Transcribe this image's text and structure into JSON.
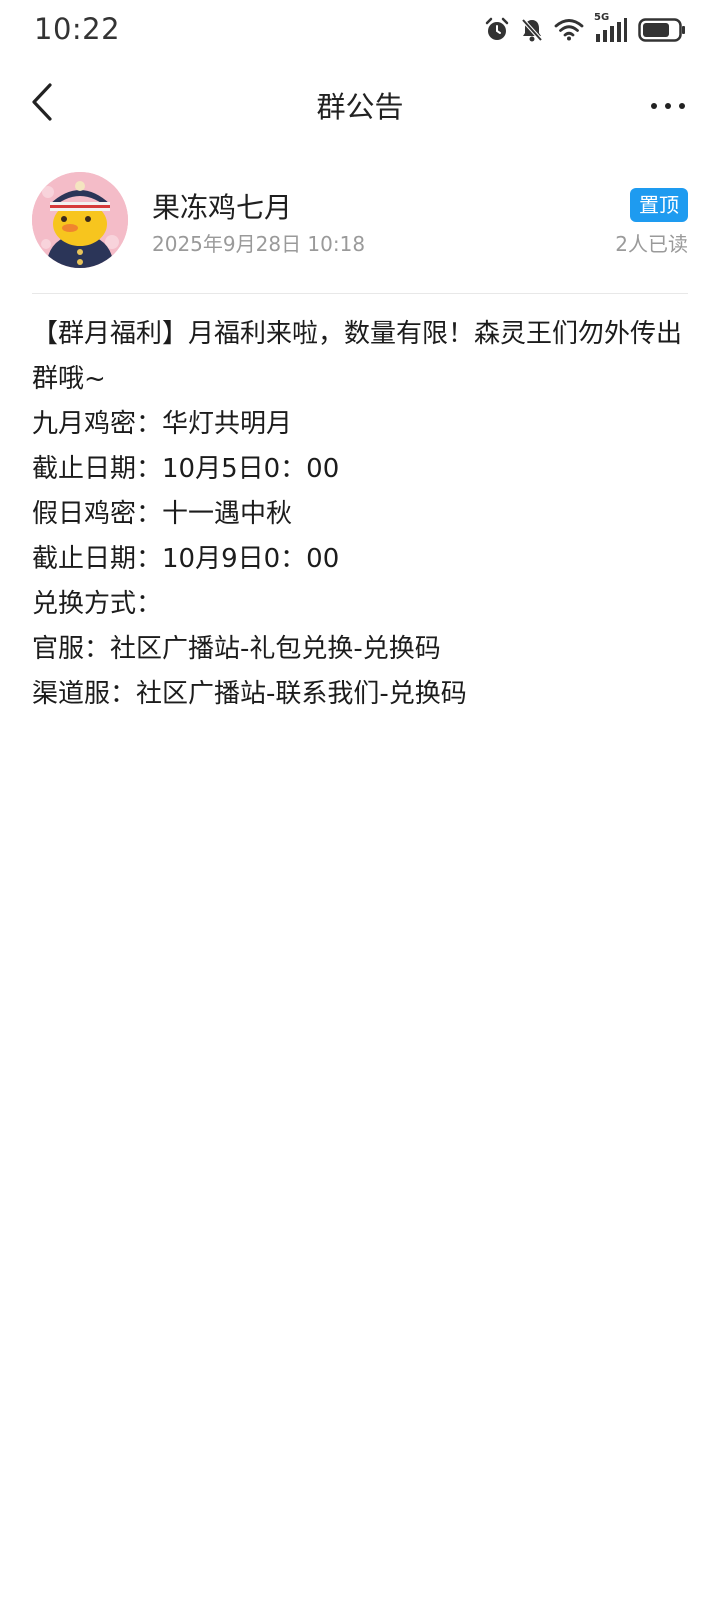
{
  "status_bar": {
    "time": "10:22",
    "icons": [
      "alarm-icon",
      "silent-icon",
      "wifi-icon",
      "5g-signal-icon",
      "battery-icon"
    ],
    "network_label": "5G"
  },
  "nav": {
    "title": "群公告",
    "back_icon": "chevron-left-icon",
    "more_icon": "more-icon"
  },
  "post": {
    "author": "果冻鸡七月",
    "time": "2025年9月28日 10:18",
    "pin_label": "置顶",
    "read_count": "2人已读"
  },
  "content": {
    "lines": [
      "【群月福利】月福利来啦，数量有限！森灵王们勿外传出群哦~",
      "九月鸡密：华灯共明月",
      "截止日期：10月5日0：00",
      "假日鸡密：十一遇中秋",
      "截止日期：10月9日0：00",
      "兑换方式：",
      "官服：社区广播站-礼包兑换-兑换码",
      "渠道服：社区广播站-联系我们-兑换码"
    ]
  },
  "colors": {
    "accent": "#1e9bf0",
    "meta_text": "#9a9a9a",
    "body_text": "#1c1c1c"
  }
}
